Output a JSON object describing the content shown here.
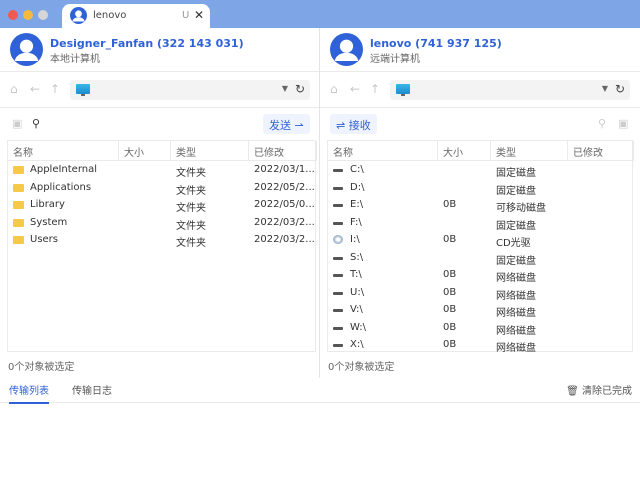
{
  "window": {
    "tab_title": "lenovo",
    "tab_badge": "U",
    "tab_close": "✕",
    "colors": {
      "accent": "#2f62d8",
      "titlebar": "#7ea6e6"
    }
  },
  "local": {
    "name": "Designer_Fanfan (322 143 031)",
    "sub": "本地计算机",
    "send": "发送 ⇀",
    "columns": [
      "名称",
      "大小",
      "类型",
      "已修改"
    ],
    "rows": [
      {
        "name": "AppleInternal",
        "size": "",
        "type": "文件夹",
        "modified": "2022/03/1..."
      },
      {
        "name": "Applications",
        "size": "",
        "type": "文件夹",
        "modified": "2022/05/2..."
      },
      {
        "name": "Library",
        "size": "",
        "type": "文件夹",
        "modified": "2022/05/0..."
      },
      {
        "name": "System",
        "size": "",
        "type": "文件夹",
        "modified": "2022/03/2..."
      },
      {
        "name": "Users",
        "size": "",
        "type": "文件夹",
        "modified": "2022/03/2..."
      }
    ],
    "status": "0个对象被选定"
  },
  "remote": {
    "name": "lenovo (741 937 125)",
    "sub": "远端计算机",
    "receive": "⇌ 接收",
    "columns": [
      "名称",
      "大小",
      "类型",
      "已修改"
    ],
    "rows": [
      {
        "name": "C:\\",
        "size": "",
        "type": "固定磁盘",
        "icon": "drive"
      },
      {
        "name": "D:\\",
        "size": "",
        "type": "固定磁盘",
        "icon": "drive"
      },
      {
        "name": "E:\\",
        "size": "0B",
        "type": "可移动磁盘",
        "icon": "drive"
      },
      {
        "name": "F:\\",
        "size": "",
        "type": "固定磁盘",
        "icon": "drive"
      },
      {
        "name": "I:\\",
        "size": "0B",
        "type": "CD光驱",
        "icon": "cd"
      },
      {
        "name": "S:\\",
        "size": "",
        "type": "固定磁盘",
        "icon": "drive"
      },
      {
        "name": "T:\\",
        "size": "0B",
        "type": "网络磁盘",
        "icon": "drive"
      },
      {
        "name": "U:\\",
        "size": "0B",
        "type": "网络磁盘",
        "icon": "drive"
      },
      {
        "name": "V:\\",
        "size": "0B",
        "type": "网络磁盘",
        "icon": "drive"
      },
      {
        "name": "W:\\",
        "size": "0B",
        "type": "网络磁盘",
        "icon": "drive"
      },
      {
        "name": "X:\\",
        "size": "0B",
        "type": "网络磁盘",
        "icon": "drive"
      }
    ],
    "status": "0个对象被选定"
  },
  "bottom": {
    "tabs": [
      "传输列表",
      "传输日志"
    ],
    "clear": "清除已完成"
  }
}
